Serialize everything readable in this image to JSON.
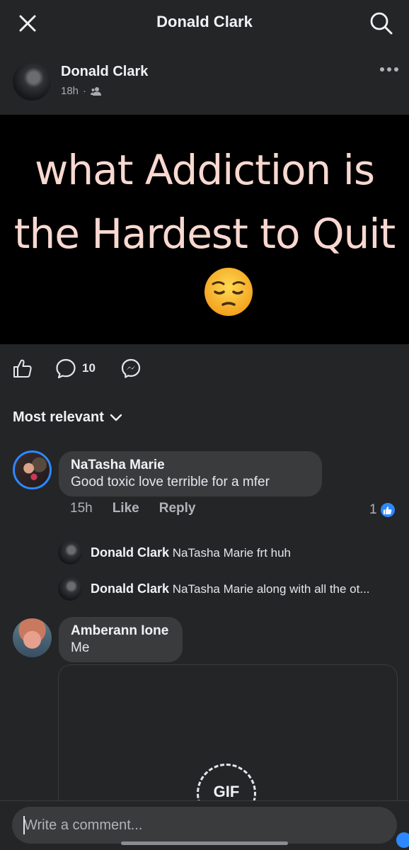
{
  "header": {
    "title": "Donald Clark"
  },
  "post": {
    "author": "Donald Clark",
    "time": "18h",
    "separator": "·",
    "image_line1": "what Addiction is",
    "image_line2": "the Hardest to Quit",
    "comment_count": "10"
  },
  "sort": {
    "label": "Most relevant"
  },
  "comments": [
    {
      "name": "NaTasha Marie",
      "text": "Good toxic love terrible for a mfer",
      "time": "15h",
      "like_label": "Like",
      "reply_label": "Reply",
      "reaction_count": "1",
      "replies": [
        {
          "name": "Donald Clark",
          "text": "NaTasha Marie frt huh"
        },
        {
          "name": "Donald Clark",
          "text": "NaTasha Marie along with all the ot..."
        }
      ]
    },
    {
      "name": "Amberann Ione",
      "text": "Me",
      "gif_label": "GIF"
    }
  ],
  "composer": {
    "placeholder": "Write a comment..."
  },
  "colors": {
    "background": "#242527",
    "bubble": "#3a3b3d",
    "accent": "#2d88ff",
    "image_text": "#f8d8d0"
  },
  "icons": {
    "close": "close-icon",
    "search": "search-icon",
    "more": "more-icon",
    "audience": "friends-icon",
    "like": "thumbs-up-icon",
    "comment": "comment-icon",
    "messenger": "messenger-icon",
    "sort": "chevron-down-icon",
    "emoji": "pensive-face-emoji"
  }
}
